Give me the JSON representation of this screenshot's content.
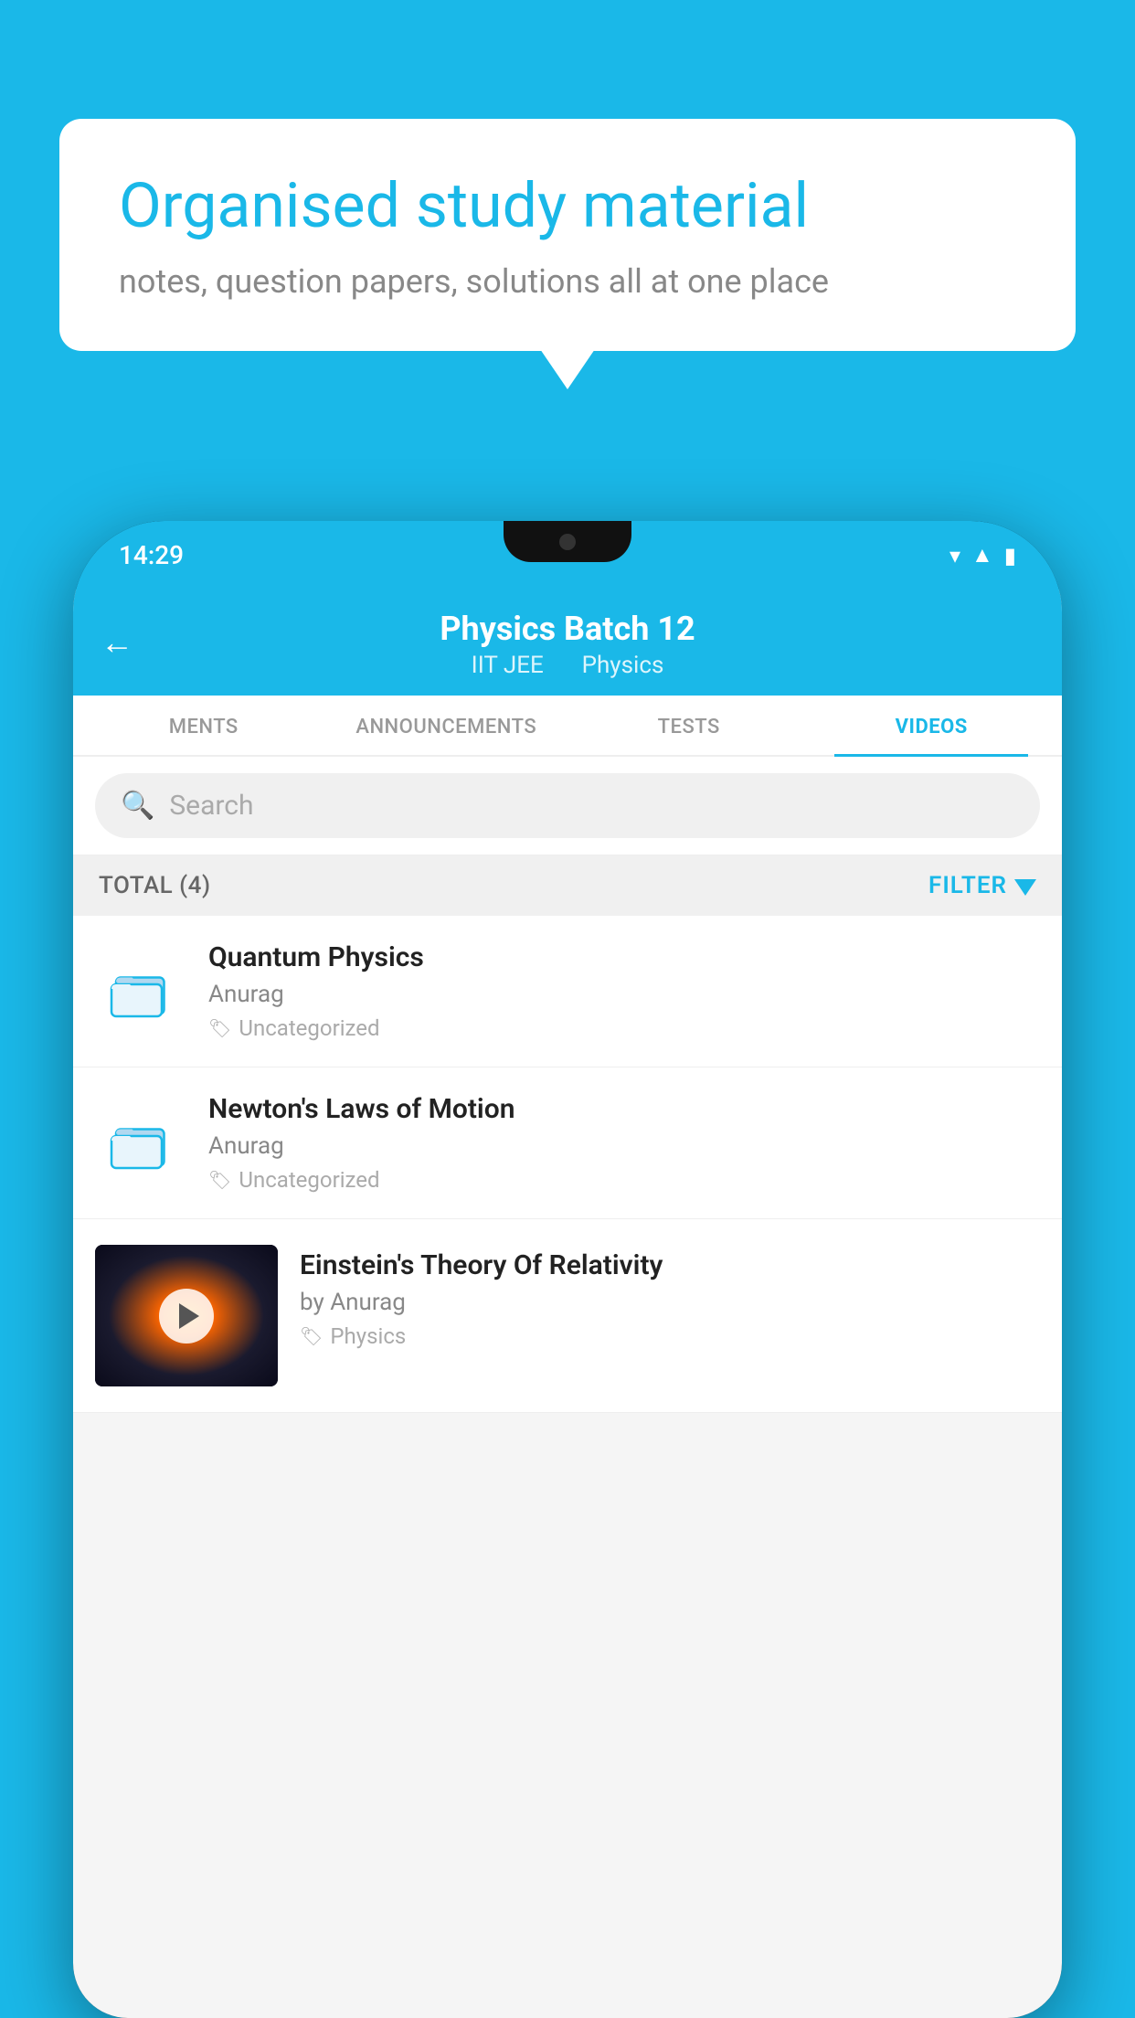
{
  "background_color": "#1ab8e8",
  "speech_bubble": {
    "title": "Organised study material",
    "subtitle": "notes, question papers, solutions all at one place"
  },
  "status_bar": {
    "time": "14:29",
    "icons": [
      "wifi",
      "signal",
      "battery"
    ]
  },
  "app_header": {
    "title": "Physics Batch 12",
    "subtitle_parts": [
      "IIT JEE",
      "Physics"
    ],
    "back_label": "←"
  },
  "tabs": [
    {
      "label": "MENTS",
      "active": false
    },
    {
      "label": "ANNOUNCEMENTS",
      "active": false
    },
    {
      "label": "TESTS",
      "active": false
    },
    {
      "label": "VIDEOS",
      "active": true
    }
  ],
  "search": {
    "placeholder": "Search"
  },
  "filter_bar": {
    "total_label": "TOTAL (4)",
    "filter_label": "FILTER"
  },
  "videos": [
    {
      "title": "Quantum Physics",
      "author": "Anurag",
      "tag": "Uncategorized",
      "type": "folder"
    },
    {
      "title": "Newton's Laws of Motion",
      "author": "Anurag",
      "tag": "Uncategorized",
      "type": "folder"
    },
    {
      "title": "Einstein's Theory Of Relativity",
      "author": "by Anurag",
      "tag": "Physics",
      "type": "video"
    }
  ]
}
